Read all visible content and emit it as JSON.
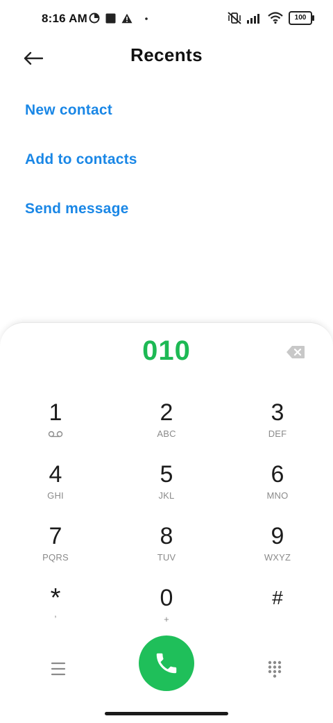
{
  "status_bar": {
    "time": "8:16 AM",
    "battery": "100"
  },
  "header": {
    "title": "Recents"
  },
  "actions": [
    {
      "label": "New contact"
    },
    {
      "label": "Add to contacts"
    },
    {
      "label": "Send message"
    }
  ],
  "dialpad": {
    "number": "010",
    "keys": [
      {
        "digit": "1",
        "letters": ""
      },
      {
        "digit": "2",
        "letters": "ABC"
      },
      {
        "digit": "3",
        "letters": "DEF"
      },
      {
        "digit": "4",
        "letters": "GHI"
      },
      {
        "digit": "5",
        "letters": "JKL"
      },
      {
        "digit": "6",
        "letters": "MNO"
      },
      {
        "digit": "7",
        "letters": "PQRS"
      },
      {
        "digit": "8",
        "letters": "TUV"
      },
      {
        "digit": "9",
        "letters": "WXYZ"
      },
      {
        "digit": "*",
        "letters": ","
      },
      {
        "digit": "0",
        "letters": "+"
      },
      {
        "digit": "#",
        "letters": ""
      }
    ]
  },
  "colors": {
    "accent_blue": "#1a87e6",
    "number_green": "#1db954",
    "call_green": "#1fbf5a"
  }
}
